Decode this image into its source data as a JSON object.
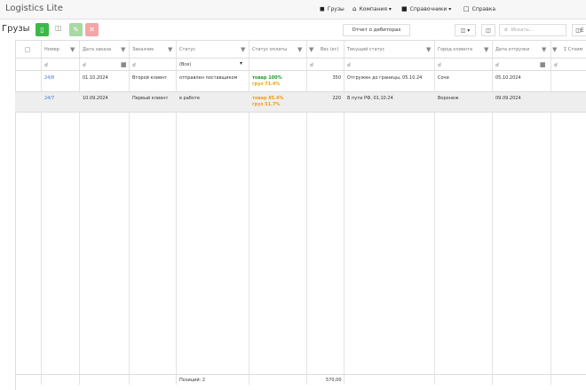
{
  "app": {
    "title": "Logistics Lite"
  },
  "nav": {
    "items": [
      {
        "label": "Грузы",
        "icon": "truck-icon"
      },
      {
        "label": "Компания ▾",
        "icon": "home-icon"
      },
      {
        "label": "Справочники ▾",
        "icon": "folder-icon"
      },
      {
        "label": "Справка",
        "icon": "document-icon"
      }
    ]
  },
  "toolbar": {
    "title": "Грузы",
    "report_label": "Отчет о дебиторах",
    "export_label": "▾",
    "search_placeholder": "Искать..."
  },
  "colors": {
    "add": "#3cb84a",
    "edit": "#a8d8a3",
    "delete": "#f4a6a6",
    "link": "#3a7bd5",
    "goods": "#1c9e2a",
    "cargo": "#f39c12",
    "row_alt": "#eeeeee"
  },
  "grid": {
    "columns": [
      "Номер",
      "Дата заказа",
      "Заказчик",
      "Статус",
      "Статус оплаты",
      "Вес (кг)",
      "Текущий статус",
      "Город клиента",
      "Дата отгрузки",
      "Σ Стоим"
    ],
    "status_filter": "(Все)",
    "rows": [
      {
        "number": "24/8",
        "date": "01.10.2024",
        "customer": "Второй клиент",
        "status": "отправлен поставщиком",
        "pay_goods": "товар 100%",
        "pay_cargo": "груз 71.4%",
        "weight": "350",
        "current": "Отгружен до границы, 05.10.24",
        "city": "Сочи",
        "ship_date": "05.10.2024"
      },
      {
        "number": "24/7",
        "date": "10.09.2024",
        "customer": "Первый клиент",
        "status": "в работе",
        "pay_goods": "товар 85.4%",
        "pay_cargo": "груз 51.7%",
        "weight": "220",
        "current": "В пути РФ, 01.10.24",
        "city": "Воронеж",
        "ship_date": "09.09.2024"
      }
    ],
    "footer": {
      "count": "Позиций: 2",
      "weight_total": "570,00"
    }
  }
}
